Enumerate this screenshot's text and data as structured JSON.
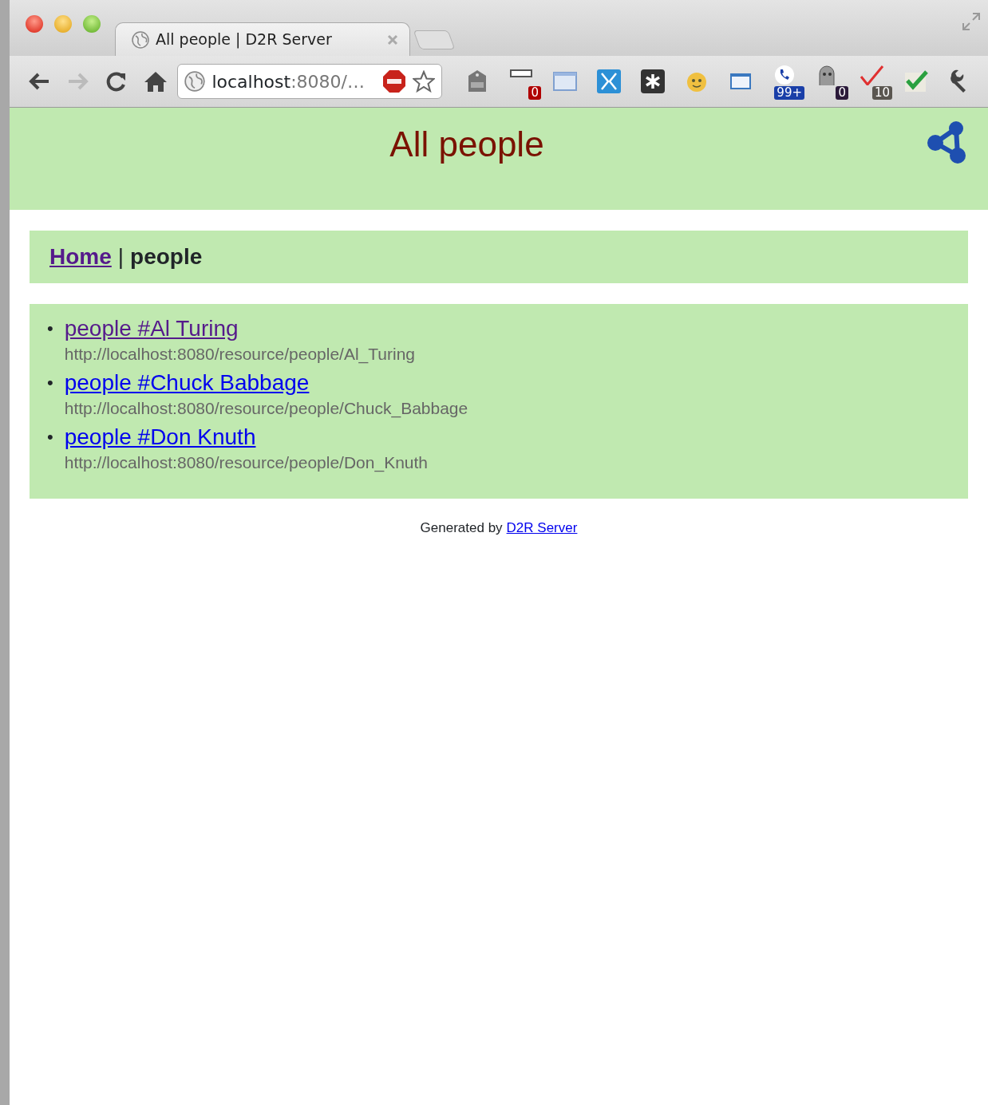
{
  "tab": {
    "title": "All people | D2R Server"
  },
  "address_bar": {
    "host": "localhost",
    "rest": ":8080/…"
  },
  "extensions": [
    {
      "kind": "tag"
    },
    {
      "kind": "bar",
      "badge": "0"
    },
    {
      "kind": "window"
    },
    {
      "kind": "butterfly"
    },
    {
      "kind": "asterisk"
    },
    {
      "kind": "face"
    },
    {
      "kind": "screen"
    },
    {
      "kind": "phone",
      "badge": "99+"
    },
    {
      "kind": "ghost",
      "badge": "0"
    },
    {
      "kind": "tick",
      "badge": "10"
    },
    {
      "kind": "check"
    },
    {
      "kind": "wrench"
    }
  ],
  "page": {
    "title": "All people",
    "breadcrumb": {
      "home": {
        "label": "Home",
        "visited": true
      },
      "separator": "|",
      "current": "people"
    },
    "items": [
      {
        "marker": "•",
        "label": "people #Al Turing",
        "uri": "http://localhost:8080/resource/people/Al_Turing",
        "visited": true
      },
      {
        "marker": "•",
        "label": "people #Chuck Babbage",
        "uri": "http://localhost:8080/resource/people/Chuck_Babbage",
        "visited": false
      },
      {
        "marker": "•",
        "label": "people #Don Knuth",
        "uri": "http://localhost:8080/resource/people/Don_Knuth",
        "visited": false
      }
    ],
    "footer": {
      "text": "Generated by",
      "link": "D2R Server"
    }
  }
}
